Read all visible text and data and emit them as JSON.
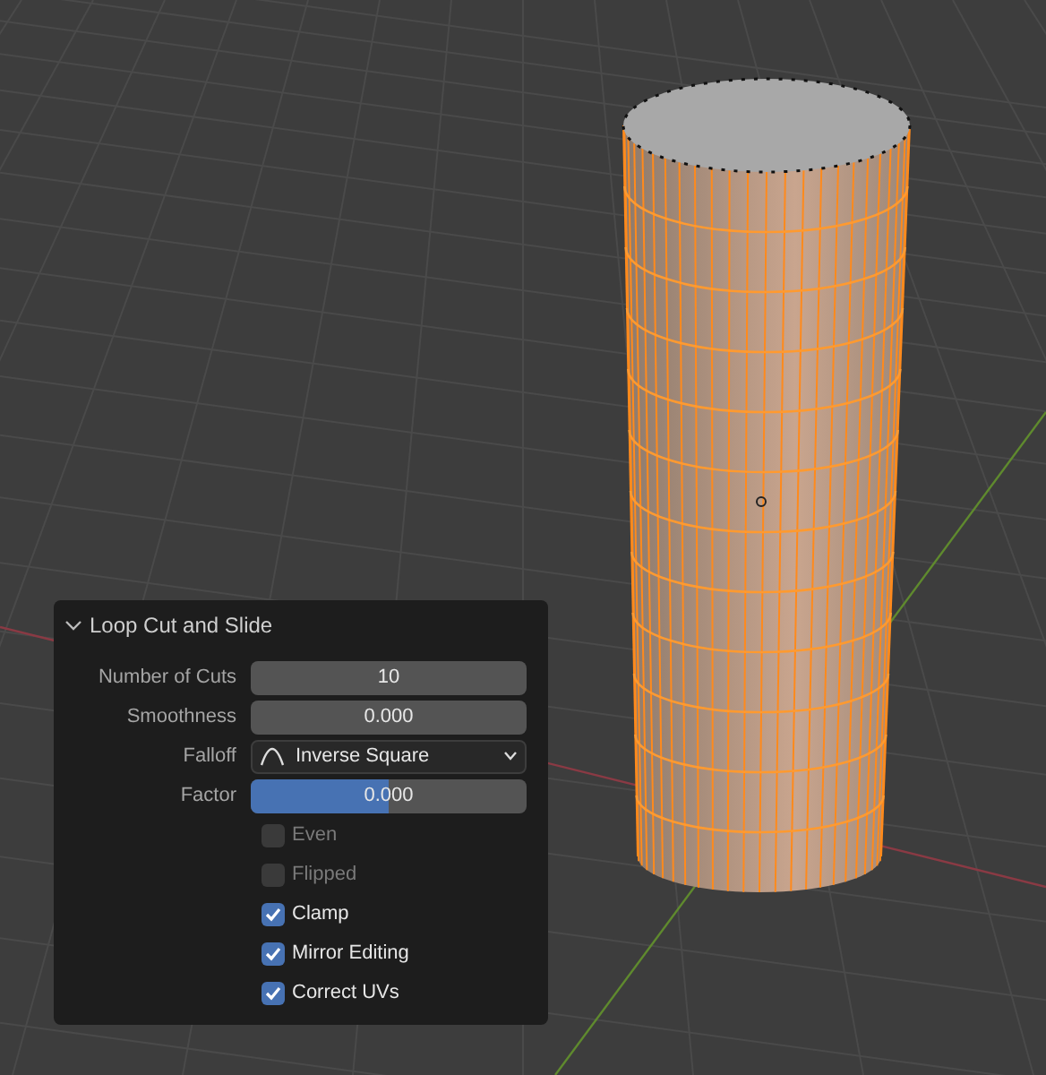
{
  "panel": {
    "title": "Loop Cut and Slide",
    "expanded": true,
    "fields": [
      {
        "kind": "number",
        "label": "Number of Cuts",
        "value": "10"
      },
      {
        "kind": "number",
        "label": "Smoothness",
        "value": "0.000"
      },
      {
        "kind": "dropdown",
        "label": "Falloff",
        "value": "Inverse Square"
      },
      {
        "kind": "slider",
        "label": "Factor",
        "value": "0.000",
        "level": 0.5
      }
    ],
    "options": [
      {
        "label": "Even",
        "checked": false,
        "disabled": true
      },
      {
        "label": "Flipped",
        "checked": false,
        "disabled": true
      },
      {
        "label": "Clamp",
        "checked": true,
        "disabled": false
      },
      {
        "label": "Mirror Editing",
        "checked": true,
        "disabled": false
      },
      {
        "label": "Correct UVs",
        "checked": true,
        "disabled": false
      }
    ]
  }
}
